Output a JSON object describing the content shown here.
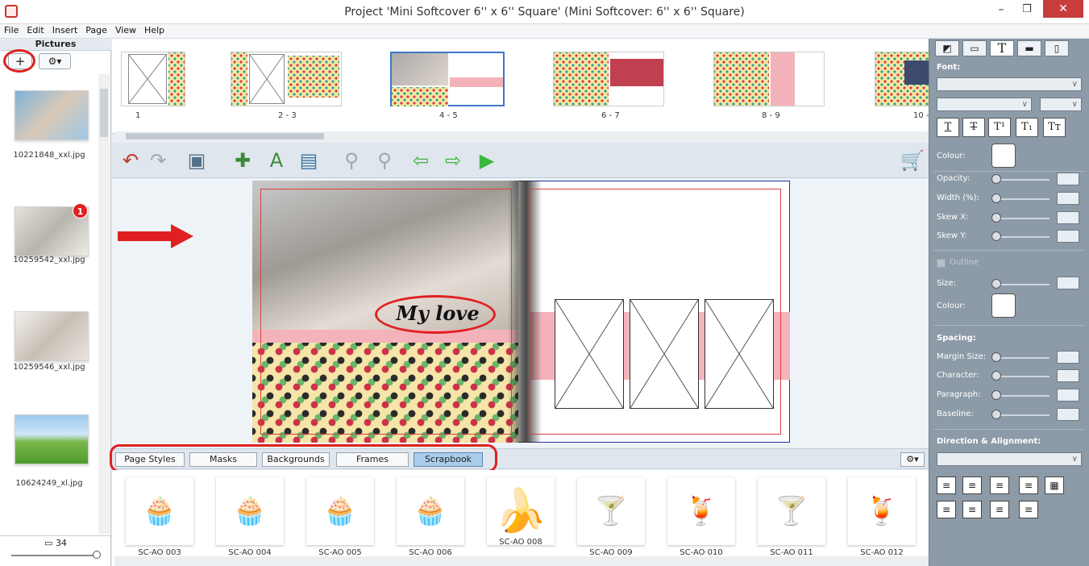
{
  "window": {
    "title": "Project 'Mini Softcover 6'' x 6'' Square' (Mini Softcover: 6'' x 6'' Square)",
    "minimize": "–",
    "maximize": "❒",
    "close": "✕"
  },
  "menu": [
    "File",
    "Edit",
    "Insert",
    "Page",
    "View",
    "Help"
  ],
  "pictures": {
    "title": "Pictures",
    "add_label": "+",
    "gear_label": "⚙▾",
    "items": [
      {
        "filename": "10221848_xxl.jpg"
      },
      {
        "filename": "10259542_xxl.jpg",
        "badge": "1"
      },
      {
        "filename": "10259546_xxl.jpg"
      },
      {
        "filename": "10624249_xl.jpg"
      }
    ],
    "count": "34"
  },
  "pages": {
    "labels": [
      "1",
      "2 - 3",
      "4 - 5",
      "6 - 7",
      "8 - 9",
      "10 -"
    ],
    "selected": "4 - 5"
  },
  "toolbar": {
    "icons": [
      "undo-icon",
      "redo-icon",
      "save-icon",
      "add-picture-icon",
      "add-text-icon",
      "import-icon",
      "zoom-out-icon",
      "zoom-in-icon",
      "prev-page-icon",
      "next-page-icon",
      "play-icon",
      "cart-icon"
    ]
  },
  "canvas": {
    "caption_text": "My love"
  },
  "tabs": {
    "items": [
      "Page Styles",
      "Masks",
      "Backgrounds",
      "Frames",
      "Scrapbook"
    ],
    "active": "Scrapbook",
    "gear_label": "⚙▾"
  },
  "stickers": [
    {
      "label": "SC-AO 003",
      "emoji": "🧁"
    },
    {
      "label": "SC-AO 004",
      "emoji": "🧁"
    },
    {
      "label": "SC-AO 005",
      "emoji": "🧁"
    },
    {
      "label": "SC-AO 006",
      "emoji": "🧁"
    },
    {
      "label": "SC-AO 008",
      "emoji": "🍌"
    },
    {
      "label": "SC-AO 009",
      "emoji": "🍸"
    },
    {
      "label": "SC-AO 010",
      "emoji": "🍹"
    },
    {
      "label": "SC-AO 011",
      "emoji": "🍸"
    },
    {
      "label": "SC-AO 012",
      "emoji": "🍹"
    }
  ],
  "text_panel": {
    "font_heading": "Font:",
    "format_buttons": [
      "T",
      "T",
      "T¹",
      "T₁",
      "Tт"
    ],
    "colour_label": "Colour:",
    "opacity_label": "Opacity:",
    "width_label": "Width (%):",
    "skewx_label": "Skew X:",
    "skewy_label": "Skew Y:",
    "outline_label": "Outline",
    "size_label": "Size:",
    "outline_colour_label": "Colour:",
    "spacing_heading": "Spacing:",
    "margin_label": "Margin Size:",
    "character_label": "Character:",
    "paragraph_label": "Paragraph:",
    "baseline_label": "Baseline:",
    "direction_heading": "Direction & Alignment:",
    "dropdown_arrow": "∨"
  },
  "colors": {
    "accent_red": "#e02020",
    "panel_bg": "#8d9ba8",
    "active_tab": "#a9cdea"
  }
}
